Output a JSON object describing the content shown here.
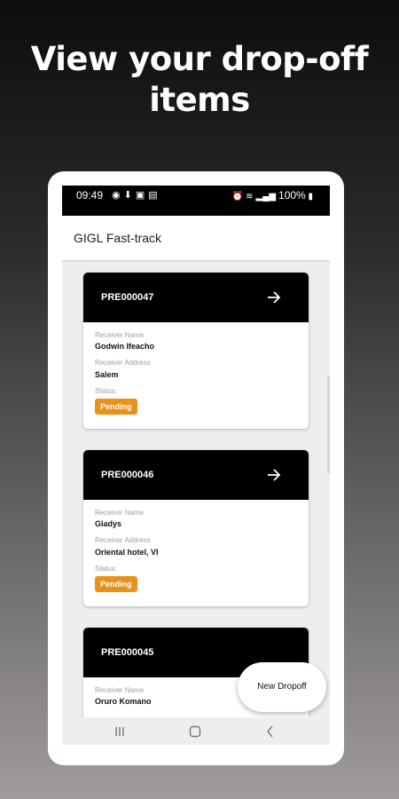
{
  "promo": {
    "headline_line1": "View your drop-off",
    "headline_line2": "items"
  },
  "status_bar": {
    "time": "09:49",
    "left_icons": [
      "notification-icon",
      "download-icon",
      "image-icon",
      "message-icon"
    ],
    "battery": "100%"
  },
  "app_bar": {
    "title": "GIGL Fast-track"
  },
  "dropoffs": [
    {
      "id": "PRE000047",
      "receiver_name_label": "Receiver Name",
      "receiver_name": "Godwin Ifeacho",
      "receiver_address_label": "Receiver Address",
      "receiver_address": "Salem",
      "status_label": "Status:",
      "status": "Pending"
    },
    {
      "id": "PRE000046",
      "receiver_name_label": "Receiver Name",
      "receiver_name": "Gladys",
      "receiver_address_label": "Receiver Address",
      "receiver_address": "Oriental hotel, VI",
      "status_label": "Status:",
      "status": "Pending"
    },
    {
      "id": "PRE000045",
      "receiver_name_label": "Receiver Name",
      "receiver_name": "Oruro Komano"
    }
  ],
  "fab": {
    "label": "New Dropoff"
  },
  "colors": {
    "card_header": "#000000",
    "status_pending": "#e8921a",
    "screen_bg": "#eeeeee"
  }
}
